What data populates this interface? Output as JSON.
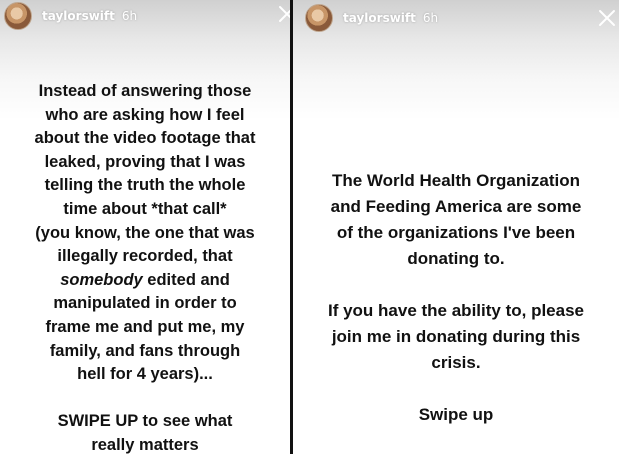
{
  "left_story": {
    "username": "taylorswift",
    "time": "6h",
    "lines_part1": [
      "Instead of answering those",
      "who are asking how I feel",
      "about the video footage that",
      "leaked, proving that I was",
      "telling the truth the whole",
      "time about *that call*",
      "(you know, the one that was",
      "illegally recorded, that"
    ],
    "line9_italic": "somebody",
    "line9_rest": " edited and",
    "lines_part2": [
      "manipulated in order to",
      "frame me and put me, my",
      "family, and fans through",
      "hell for 4 years)..."
    ],
    "cta_lines": [
      "SWIPE UP to see what",
      "really matters"
    ]
  },
  "right_story": {
    "username": "taylorswift",
    "time": "6h",
    "paragraph1": [
      "The World Health Organization",
      "and Feeding America are some",
      "of the organizations I've been",
      "donating to."
    ],
    "paragraph2": [
      "If you have the ability to, please",
      "join me in donating during this",
      "crisis."
    ],
    "cta": "Swipe up"
  },
  "colors": {
    "text": "#111111",
    "divider": "#111111",
    "header_text": "#ffffff"
  }
}
